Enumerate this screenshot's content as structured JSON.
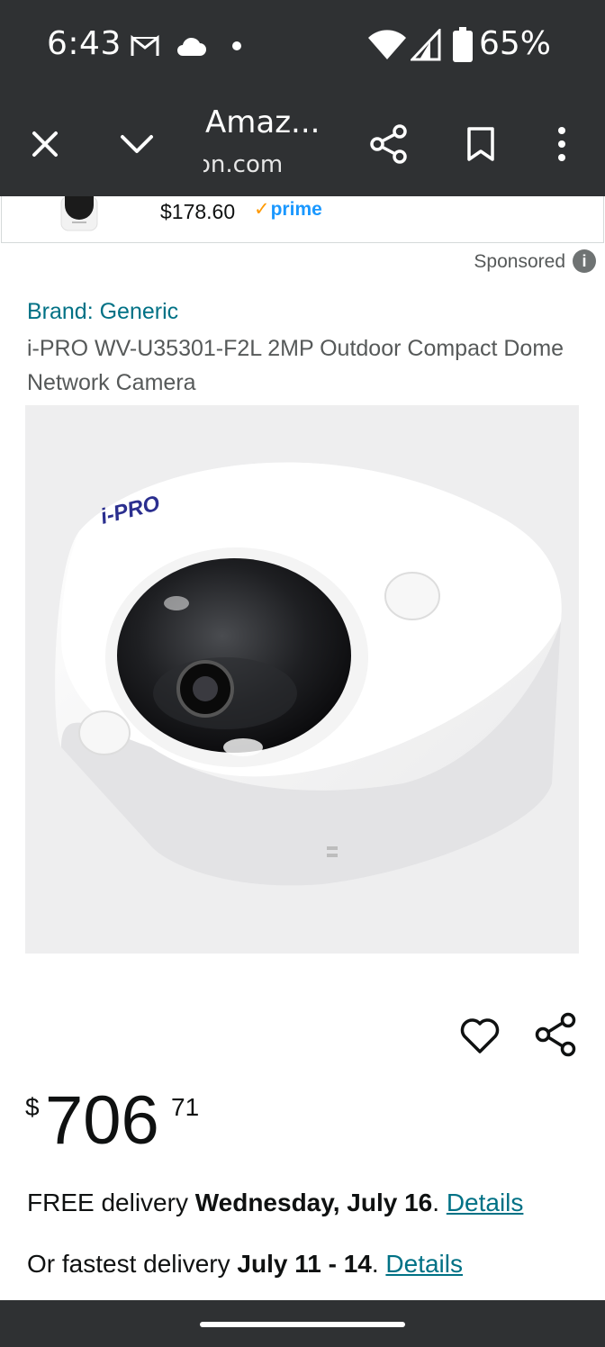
{
  "status_bar": {
    "time": "6:43",
    "battery": "65%",
    "icons": [
      "gmail-icon",
      "cloud-icon",
      "dot-icon",
      "wifi-icon",
      "signal-icon",
      "battery-icon"
    ]
  },
  "browser": {
    "tab_title": "Amaz...",
    "tab_url": "on.com",
    "icons": [
      "close-icon",
      "chevron-down-icon",
      "share-icon",
      "bookmark-icon",
      "more-vert-icon"
    ]
  },
  "sponsored": {
    "price": "$178.60",
    "prime_label": "prime",
    "label": "Sponsored",
    "info_glyph": "i"
  },
  "product": {
    "brand": "Brand: Generic",
    "title": "i-PRO WV-U35301-F2L 2MP Outdoor Compact Dome Network Camera",
    "logo_text": "i-PRO",
    "price": {
      "symbol": "$",
      "whole": "706",
      "fraction": "71"
    }
  },
  "delivery": {
    "line1": {
      "prefix": "FREE delivery ",
      "date": "Wednesday, July 16",
      "suffix": ". ",
      "link": "Details"
    },
    "line2": {
      "prefix": "Or fastest delivery ",
      "date": "July 11 - 14",
      "suffix": ". ",
      "link": "Details"
    }
  },
  "colors": {
    "chrome_bg": "#2f3133",
    "link": "#007185",
    "prime_blue": "#1a98ff",
    "prime_check": "#ff9900",
    "image_bg": "#eeeeef"
  }
}
